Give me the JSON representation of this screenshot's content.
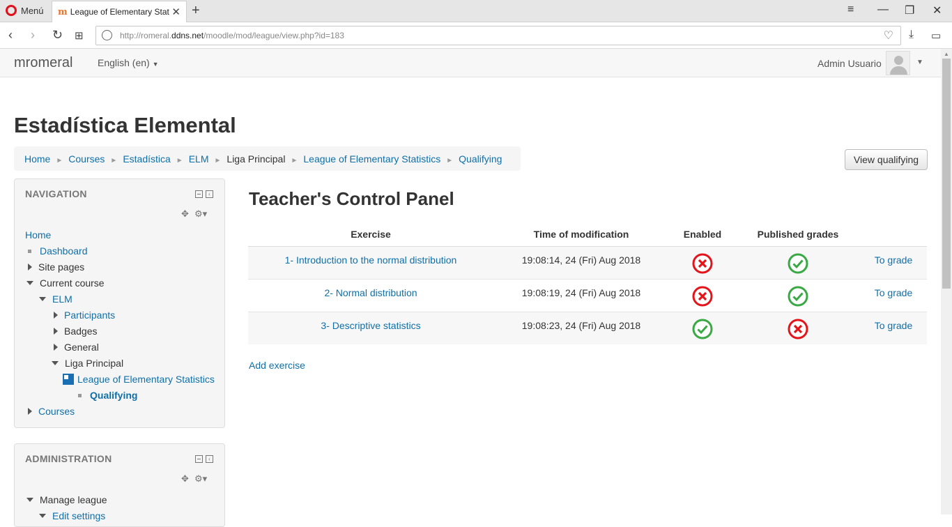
{
  "browser": {
    "menu_label": "Menú",
    "tab_title": "League of Elementary Statistics",
    "url_prefix": "http://romeral.",
    "url_host": "ddns.net",
    "url_path": "/moodle/mod/league/view.php?id=183"
  },
  "navbar": {
    "brand": "mromeral",
    "language": "English (en)",
    "user_name": "Admin Usuario"
  },
  "page": {
    "title": "Estadística Elemental",
    "view_button": "View qualifying"
  },
  "breadcrumb": [
    {
      "label": "Home",
      "link": true
    },
    {
      "label": "Courses",
      "link": true
    },
    {
      "label": "Estadística",
      "link": true
    },
    {
      "label": "ELM",
      "link": true
    },
    {
      "label": "Liga Principal",
      "link": false
    },
    {
      "label": "League of Elementary Statistics",
      "link": true
    },
    {
      "label": "Qualifying",
      "link": true
    }
  ],
  "navigation_block": {
    "title": "NAVIGATION",
    "items": {
      "home": "Home",
      "dashboard": "Dashboard",
      "site_pages": "Site pages",
      "current_course": "Current course",
      "elm": "ELM",
      "participants": "Participants",
      "badges": "Badges",
      "general": "General",
      "liga_principal": "Liga Principal",
      "league": "League of Elementary Statistics",
      "qualifying": "Qualifying",
      "courses": "Courses"
    }
  },
  "administration_block": {
    "title": "ADMINISTRATION",
    "items": {
      "manage_league": "Manage league",
      "edit_settings": "Edit settings"
    }
  },
  "panel": {
    "heading": "Teacher's Control Panel",
    "columns": [
      "Exercise",
      "Time of modification",
      "Enabled",
      "Published grades"
    ],
    "rows": [
      {
        "exercise": "1- Introduction to the normal distribution",
        "time": "19:08:14, 24 (Fri) Aug 2018",
        "enabled": false,
        "published": true,
        "action": "To grade"
      },
      {
        "exercise": "2- Normal distribution",
        "time": "19:08:19, 24 (Fri) Aug 2018",
        "enabled": false,
        "published": true,
        "action": "To grade"
      },
      {
        "exercise": "3- Descriptive statistics",
        "time": "19:08:23, 24 (Fri) Aug 2018",
        "enabled": true,
        "published": false,
        "action": "To grade"
      }
    ],
    "add_link": "Add exercise"
  },
  "colors": {
    "link": "#0f6fa9",
    "check": "#3aa845",
    "cross": "#e4141b"
  }
}
